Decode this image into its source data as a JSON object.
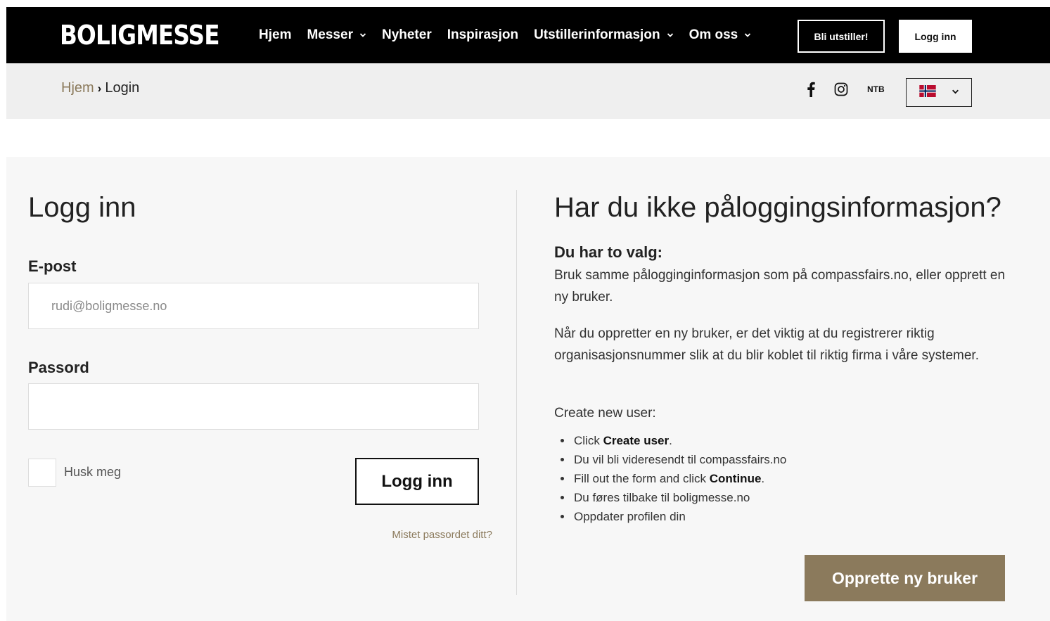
{
  "header": {
    "logo": "BOLIGMESSE",
    "nav": [
      {
        "label": "Hjem",
        "dropdown": false
      },
      {
        "label": "Messer",
        "dropdown": true
      },
      {
        "label": "Nyheter",
        "dropdown": false
      },
      {
        "label": "Inspirasjon",
        "dropdown": false
      },
      {
        "label": "Utstillerinformasjon",
        "dropdown": true
      },
      {
        "label": "Om oss",
        "dropdown": true
      }
    ],
    "exhibitor_button": "Bli utstiller!",
    "login_button": "Logg inn"
  },
  "subbar": {
    "breadcrumb_home": "Hjem",
    "breadcrumb_current": "Login",
    "ntb": "NTB",
    "language_icon": "norway-flag-icon"
  },
  "login": {
    "title": "Logg inn",
    "email_label": "E-post",
    "email_placeholder": "rudi@boligmesse.no",
    "password_label": "Passord",
    "remember_label": "Husk meg",
    "submit_label": "Logg inn",
    "forgot_link": "Mistet passordet ditt?"
  },
  "info": {
    "title": "Har du ikke påloggingsinformasjon?",
    "subtitle": "Du har to valg:",
    "paragraph1": "Bruk samme pålogginginformasjon som på compassfairs.no, eller opprett en ny bruker.",
    "paragraph2": "Når du oppretter en ny bruker, er det viktig at du registrerer riktig organisasjonsnummer slik at du blir koblet til riktig firma i våre systemer.",
    "paragraph3": "Create new user:",
    "steps": {
      "s1_pre": "Click ",
      "s1_bold": "Create user",
      "s1_post": ".",
      "s2": "Du vil bli videresendt til compassfairs.no",
      "s3_pre": "Fill out the form and click ",
      "s3_bold": "Continue",
      "s3_post": ".",
      "s4": "Du føres tilbake til boligmesse.no",
      "s5": "Oppdater profilen din"
    },
    "create_button": "Opprette ny bruker"
  },
  "colors": {
    "accent": "#8b7a5c",
    "topbar": "#000000",
    "subbar": "#efefef",
    "main_bg": "#f7f7f7"
  }
}
